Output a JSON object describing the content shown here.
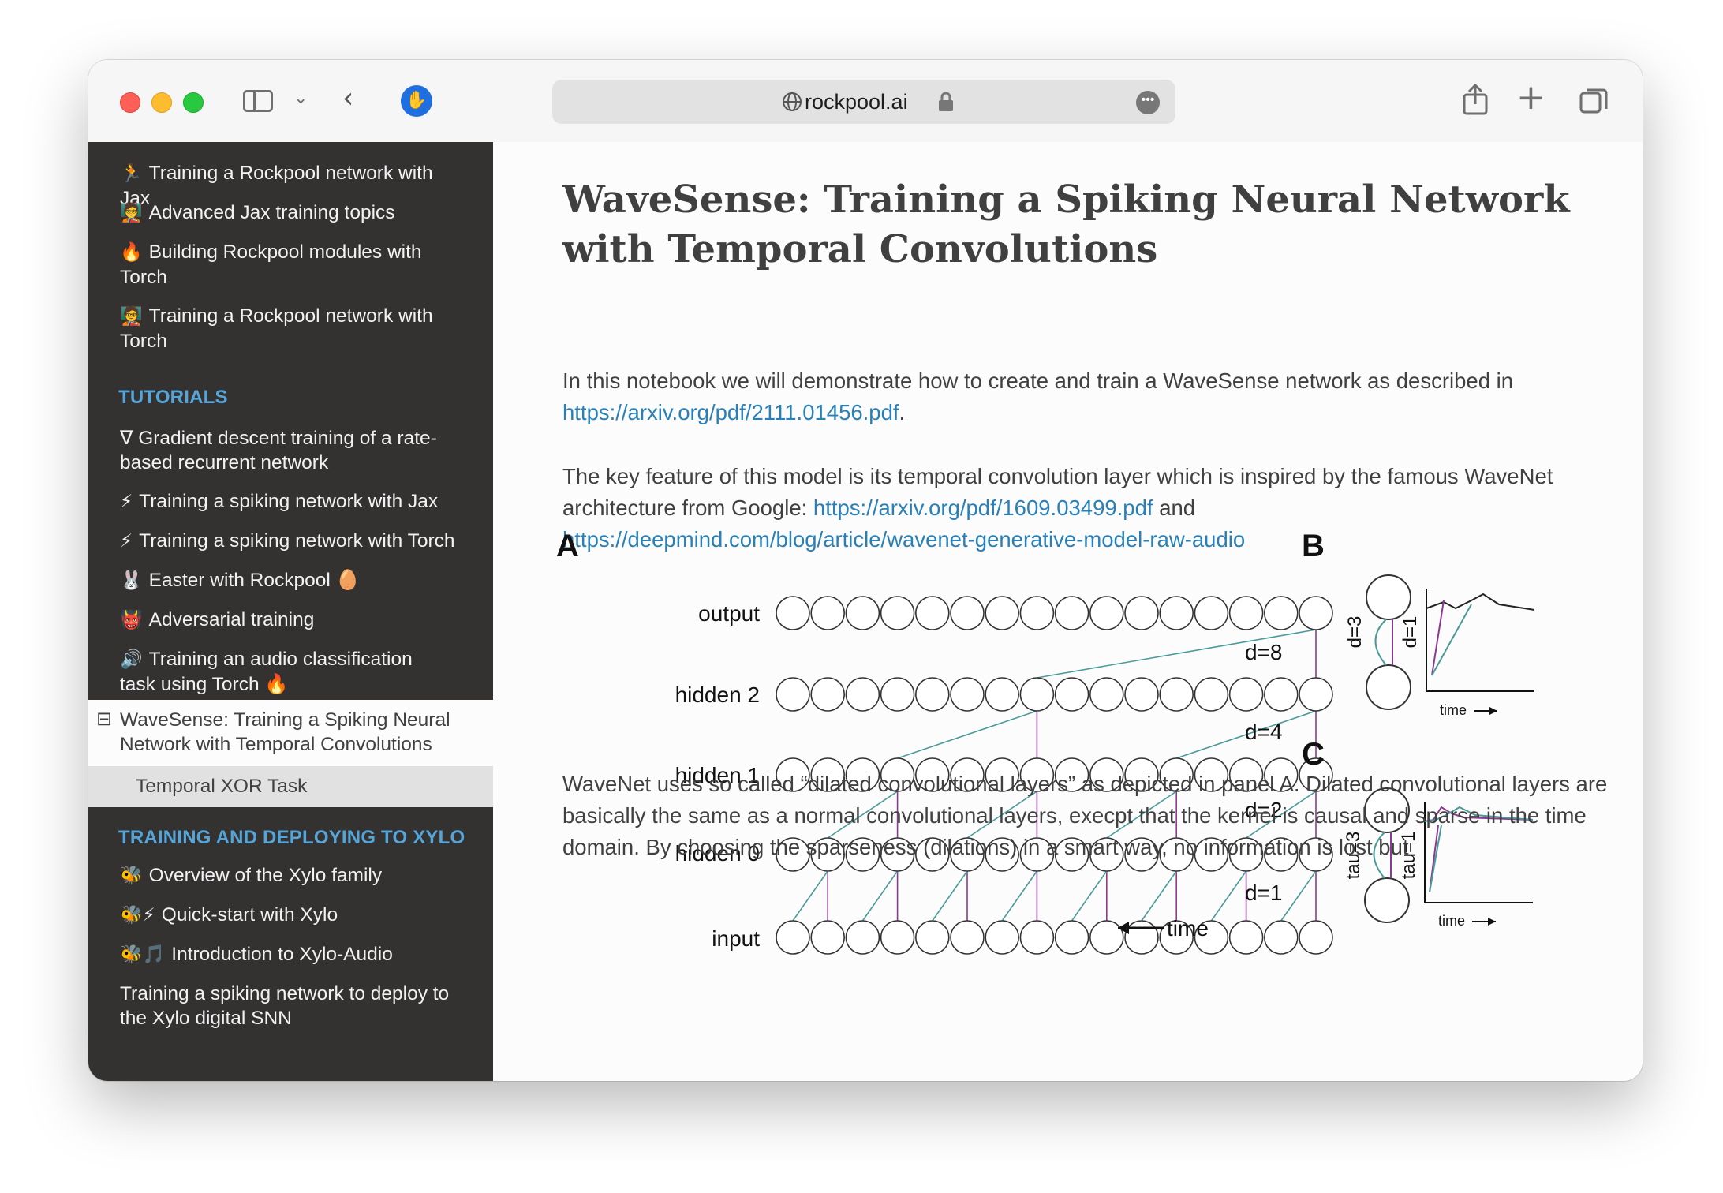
{
  "browser": {
    "url": "rockpool.ai"
  },
  "sidebar": {
    "items_top": [
      {
        "emoji": "🏃",
        "label": "Training a Rockpool network with Jax"
      },
      {
        "emoji": "🧑‍🏫",
        "label": "Advanced Jax training topics"
      },
      {
        "emoji": "🔥",
        "label": "Building Rockpool modules with Torch"
      },
      {
        "emoji": "🧑‍🏫",
        "label": "Training a Rockpool network with Torch"
      }
    ],
    "caption_tutorials": "TUTORIALS",
    "tutorials": [
      {
        "emoji": "",
        "label": "∇ Gradient descent training of a rate-based recurrent network"
      },
      {
        "emoji": "⚡",
        "label": "Training a spiking network with Jax"
      },
      {
        "emoji": "⚡",
        "label": "Training a spiking network with Torch"
      },
      {
        "emoji": "🐰",
        "label": "Easter with Rockpool 🥚"
      },
      {
        "emoji": "👹",
        "label": "Adversarial training"
      },
      {
        "emoji": "🔊",
        "label": "Training an audio classification task using Torch 🔥"
      }
    ],
    "current": "WaveSense: Training a Spiking Neural Network with Temporal Convolutions",
    "current_toggle": "⊟",
    "subitem": "Temporal XOR Task",
    "caption_xylo": "TRAINING AND DEPLOYING TO XYLO",
    "xylo": [
      {
        "emoji": "🐝",
        "label": "Overview of the Xylo family"
      },
      {
        "emoji": "🐝⚡",
        "label": "Quick-start with Xylo"
      },
      {
        "emoji": "🐝🎵",
        "label": "Introduction to Xylo-Audio"
      },
      {
        "emoji": "",
        "label": "Training a spiking network to deploy to the Xylo digital SNN"
      }
    ]
  },
  "main": {
    "title": "WaveSense: Training a Spiking Neural Network with Temporal Convolutions",
    "p1_text": "In this notebook we will demonstrate how to create and train a WaveSense network as described in",
    "p1_link": "https://arxiv.org/pdf/2111.01456.pdf",
    "p1_end": ".",
    "p2_text": "The key feature of this model is its temporal convolution layer which is inspired by the famous WaveNet architecture from Google:",
    "p2_link1": "https://arxiv.org/pdf/1609.03499.pdf",
    "p2_and": "and",
    "p2_link2": "https://deepmind.com/blog/article/wavenet-generative-model-raw-audio",
    "p3_text": "WaveNet uses so called “dilated convolutional layers” as depicted in panel A. Dilated convolutional layers are basically the same as a normal convolutional layers, execpt that the kernel is causal and sparse in the time domain. By choosing the sparseness (dilations) in a smart way, no information is lost but"
  },
  "figure": {
    "panel_a": "A",
    "panel_b": "B",
    "panel_c": "C",
    "layers": [
      "output",
      "hidden 2",
      "hidden 1",
      "hidden 0",
      "input"
    ],
    "dilations": [
      "d=8",
      "d=4",
      "d=2",
      "d=1"
    ],
    "time_label": "time",
    "b_labels": [
      "d=3",
      "d=1"
    ],
    "c_labels": [
      "tau=3",
      "tau=1"
    ],
    "colors": {
      "teal": "#4a9a9a",
      "purple": "#8a3b8f",
      "node": "#ffffff",
      "stroke": "#333333"
    }
  }
}
